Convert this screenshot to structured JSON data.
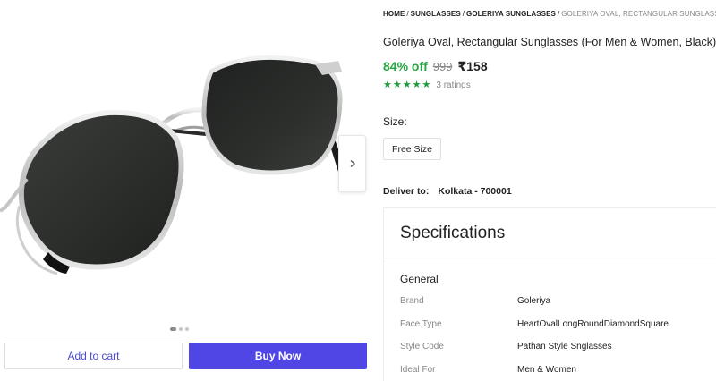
{
  "colors": {
    "accent": "#4f46e5",
    "discount": "#26a541",
    "rating": "#1e9b3c",
    "muted": "#878787"
  },
  "gallery": {
    "next_icon": "chevron-right-icon",
    "add_to_cart_label": "Add to cart",
    "buy_now_label": "Buy Now"
  },
  "breadcrumb": {
    "items": [
      "HOME",
      "SUNGLASSES",
      "GOLERIYA SUNGLASSES"
    ],
    "current": "GOLERIYA OVAL, RECTANGULAR SUNGLASSES (FOR M",
    "separator": "/"
  },
  "product": {
    "title": "Goleriya Oval, Rectangular Sunglasses (For Men & Women, Black)",
    "discount": "84% off",
    "mrp": "999",
    "price": "₹158",
    "rating_count": "3 ratings",
    "star_rating": 5
  },
  "size": {
    "label": "Size:",
    "selected": "Free Size"
  },
  "delivery": {
    "label": "Deliver to:",
    "location": "Kolkata - 700001"
  },
  "specifications": {
    "heading": "Specifications",
    "group": "General",
    "rows": [
      {
        "key": "Brand",
        "value": "Goleriya"
      },
      {
        "key": "Face Type",
        "value": "HeartOvalLongRoundDiamondSquare"
      },
      {
        "key": "Style Code",
        "value": "Pathan Style Snglasses"
      },
      {
        "key": "Ideal For",
        "value": "Men & Women"
      }
    ]
  }
}
